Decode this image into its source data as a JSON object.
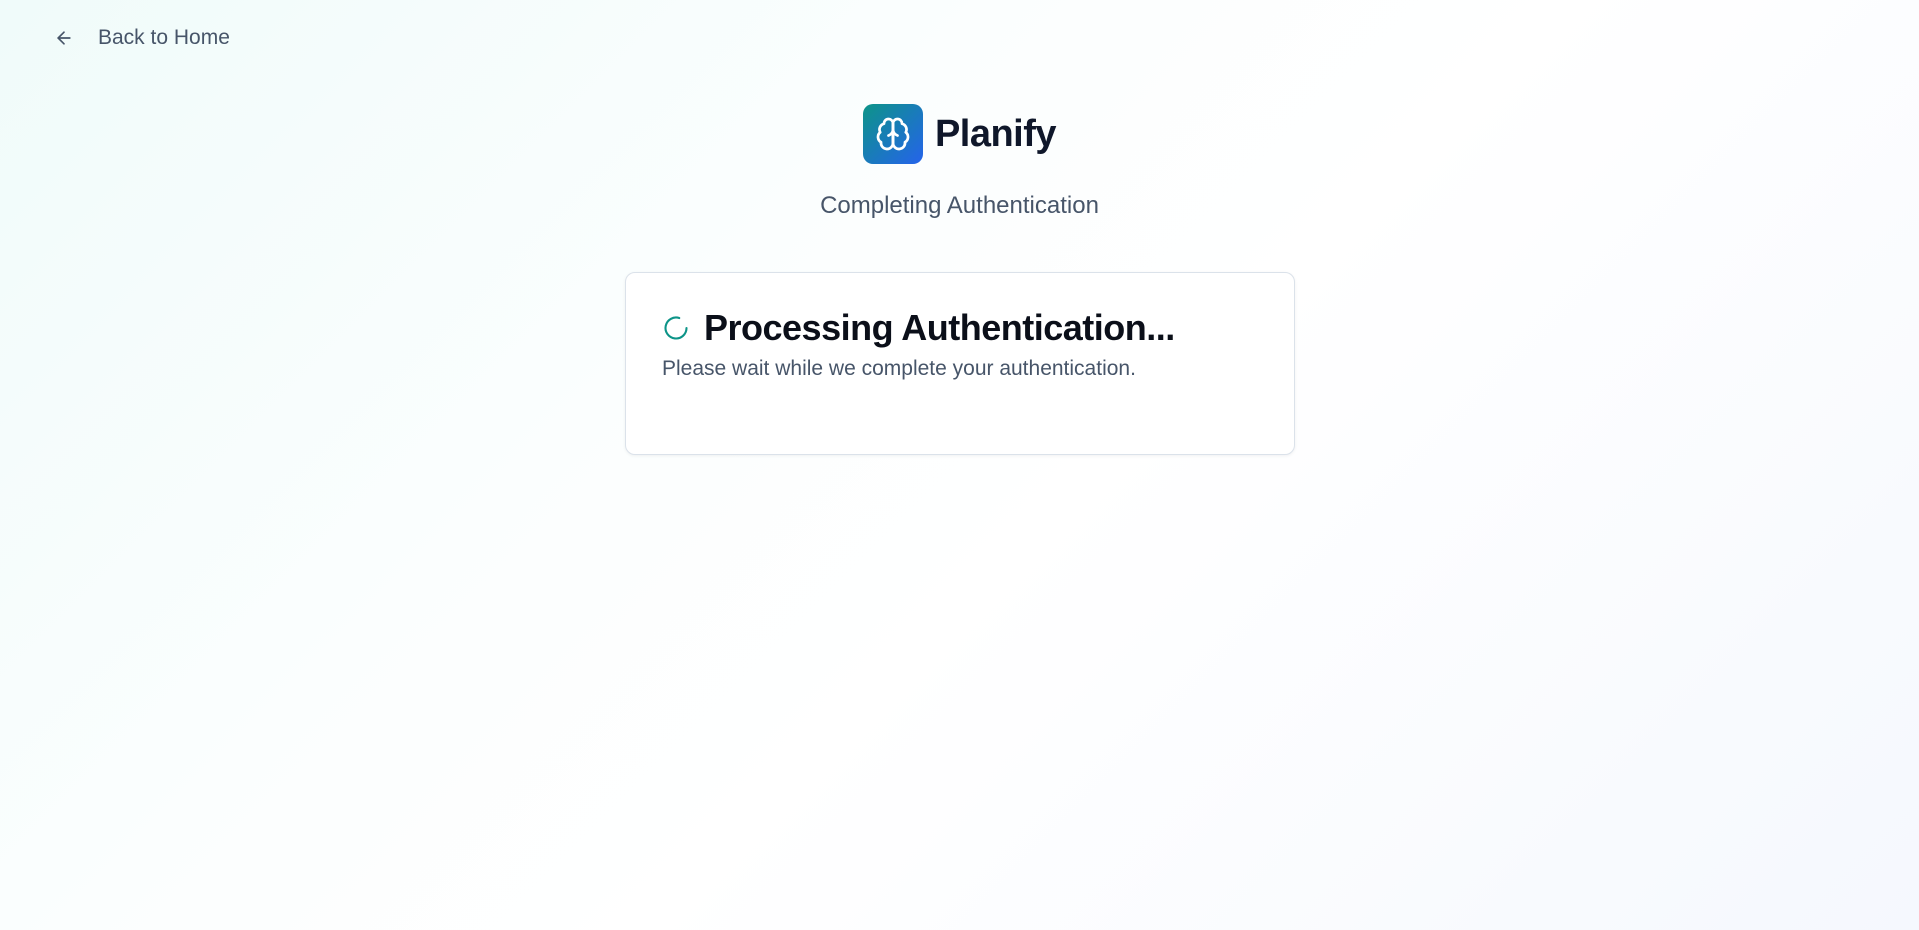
{
  "nav": {
    "back_label": "Back to Home",
    "back_icon": "arrow-left-icon"
  },
  "brand": {
    "name": "Planify",
    "logo_icon": "brain-icon",
    "logo_gradient": [
      "#0d9488",
      "#2563eb"
    ]
  },
  "header": {
    "subtitle": "Completing Authentication"
  },
  "card": {
    "title": "Processing Authentication...",
    "description": "Please wait while we complete your authentication.",
    "status_icon": "loading-spinner-icon",
    "accent_color": "#0d9488"
  }
}
